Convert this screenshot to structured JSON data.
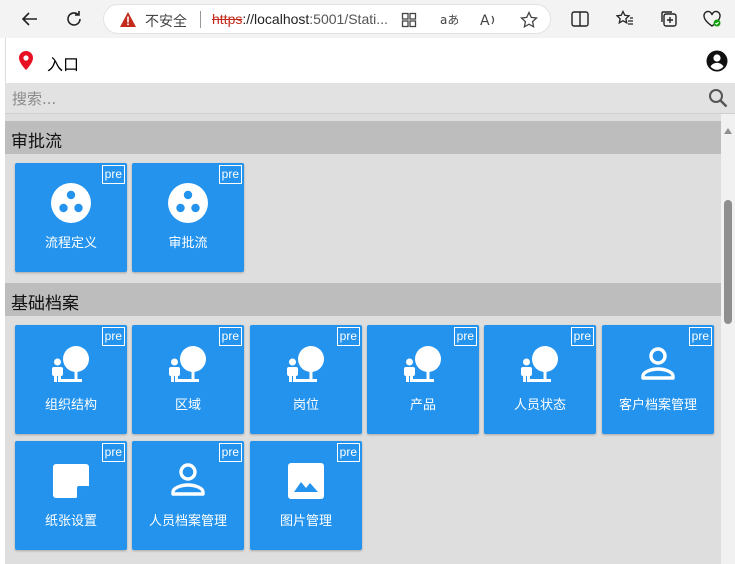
{
  "browser": {
    "insecure_label": "不安全",
    "url_proto": "https",
    "url_host": "://localhost",
    "url_rest": ":5001/Stati..."
  },
  "app": {
    "title": "入口"
  },
  "search": {
    "placeholder": "搜索..."
  },
  "sections": [
    {
      "title": "审批流",
      "tiles": [
        {
          "label": "流程定义",
          "badge": "pre",
          "icon": "hub-icon"
        },
        {
          "label": "审批流",
          "badge": "pre",
          "icon": "hub-icon"
        }
      ]
    },
    {
      "title": "基础档案",
      "tiles": [
        {
          "label": "组织结构",
          "badge": "pre",
          "icon": "nature-people-icon"
        },
        {
          "label": "区域",
          "badge": "pre",
          "icon": "nature-people-icon"
        },
        {
          "label": "岗位",
          "badge": "pre",
          "icon": "nature-people-icon"
        },
        {
          "label": "产品",
          "badge": "pre",
          "icon": "nature-people-icon"
        },
        {
          "label": "人员状态",
          "badge": "pre",
          "icon": "nature-people-icon"
        },
        {
          "label": "客户档案管理",
          "badge": "pre",
          "icon": "person-outline-icon"
        },
        {
          "label": "纸张设置",
          "badge": "pre",
          "icon": "note-icon"
        },
        {
          "label": "人员档案管理",
          "badge": "pre",
          "icon": "person-outline-icon"
        },
        {
          "label": "图片管理",
          "badge": "pre",
          "icon": "image-icon"
        }
      ]
    }
  ],
  "colors": {
    "tile": "#2393ee",
    "section_header": "#bdbdbd",
    "content_bg": "#dedede",
    "location_pin": "#e81123",
    "insecure_warning": "#c42b1c"
  }
}
